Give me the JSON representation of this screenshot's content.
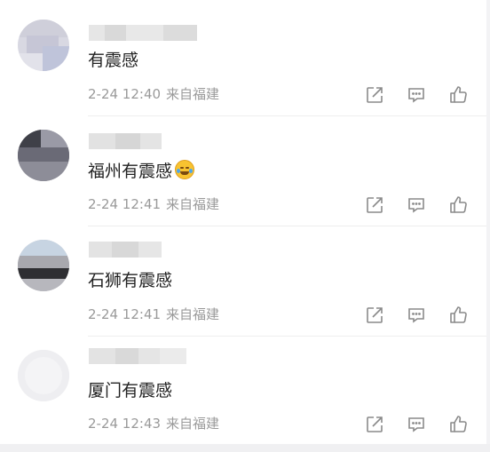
{
  "comments": [
    {
      "text": "有震感",
      "has_emoji": false,
      "time": "2-24 12:40",
      "location": "来自福建",
      "actions": {
        "share_icon": "share-edit-icon",
        "reply_icon": "comment-icon",
        "like_icon": "thumbs-up-icon"
      }
    },
    {
      "text": "福州有震感",
      "has_emoji": true,
      "emoji_icon": "laughing-crying-emoji-icon",
      "time": "2-24 12:41",
      "location": "来自福建",
      "actions": {
        "share_icon": "share-edit-icon",
        "reply_icon": "comment-icon",
        "like_icon": "thumbs-up-icon"
      }
    },
    {
      "text": "石狮有震感",
      "has_emoji": false,
      "time": "2-24 12:41",
      "location": "来自福建",
      "actions": {
        "share_icon": "share-edit-icon",
        "reply_icon": "comment-icon",
        "like_icon": "thumbs-up-icon"
      }
    },
    {
      "text": "厦门有震感",
      "has_emoji": false,
      "time": "2-24 12:43",
      "location": "来自福建",
      "actions": {
        "share_icon": "share-edit-icon",
        "reply_icon": "comment-icon",
        "like_icon": "thumbs-up-icon"
      }
    }
  ],
  "colors": {
    "text": "#222222",
    "meta": "#9a9a9a",
    "icon": "#8a8a8a",
    "divider": "#eeeeee"
  }
}
